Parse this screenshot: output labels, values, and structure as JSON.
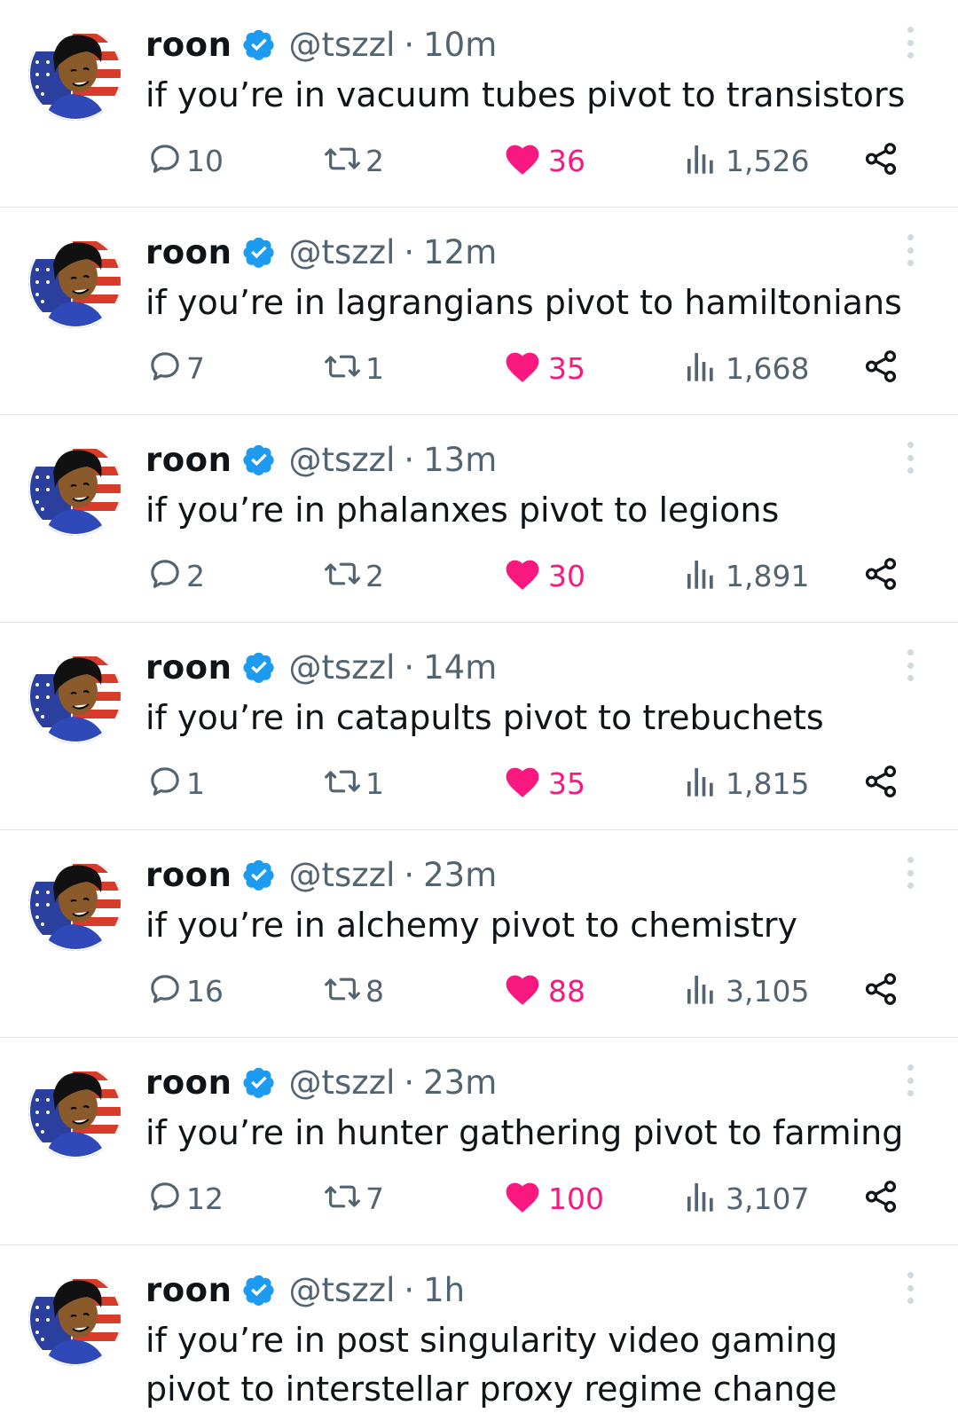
{
  "colors": {
    "verified": "#1d9bf0",
    "like": "#f91880",
    "muted": "#536471",
    "text": "#0f1419",
    "divider": "#e6e6e6"
  },
  "tweets": [
    {
      "name": "roon",
      "handle": "@tszzl",
      "separator": "·",
      "time": "10m",
      "text": "if you’re in vacuum tubes pivot to transistors",
      "replies": "10",
      "retweets": "2",
      "likes": "36",
      "views": "1,526"
    },
    {
      "name": "roon",
      "handle": "@tszzl",
      "separator": "·",
      "time": "12m",
      "text": "if you’re in lagrangians pivot to hamiltonians",
      "replies": "7",
      "retweets": "1",
      "likes": "35",
      "views": "1,668"
    },
    {
      "name": "roon",
      "handle": "@tszzl",
      "separator": "·",
      "time": "13m",
      "text": "if you’re in phalanxes pivot to legions",
      "replies": "2",
      "retweets": "2",
      "likes": "30",
      "views": "1,891"
    },
    {
      "name": "roon",
      "handle": "@tszzl",
      "separator": "·",
      "time": "14m",
      "text": "if you’re in catapults pivot to trebuchets",
      "replies": "1",
      "retweets": "1",
      "likes": "35",
      "views": "1,815"
    },
    {
      "name": "roon",
      "handle": "@tszzl",
      "separator": "·",
      "time": "23m",
      "text": "if you’re in alchemy pivot to chemistry",
      "replies": "16",
      "retweets": "8",
      "likes": "88",
      "views": "3,105"
    },
    {
      "name": "roon",
      "handle": "@tszzl",
      "separator": "·",
      "time": "23m",
      "text": "if you’re in hunter gathering pivot to farming",
      "replies": "12",
      "retweets": "7",
      "likes": "100",
      "views": "3,107"
    },
    {
      "name": "roon",
      "handle": "@tszzl",
      "separator": "·",
      "time": "1h",
      "text": "if you’re in post singularity video gaming pivot to interstellar proxy regime change"
    }
  ],
  "icons": {
    "reply": "reply-icon",
    "retweet": "retweet-icon",
    "like": "heart-icon",
    "views": "views-icon",
    "share": "share-icon",
    "verified": "verified-badge-icon",
    "more": "more-icon"
  }
}
